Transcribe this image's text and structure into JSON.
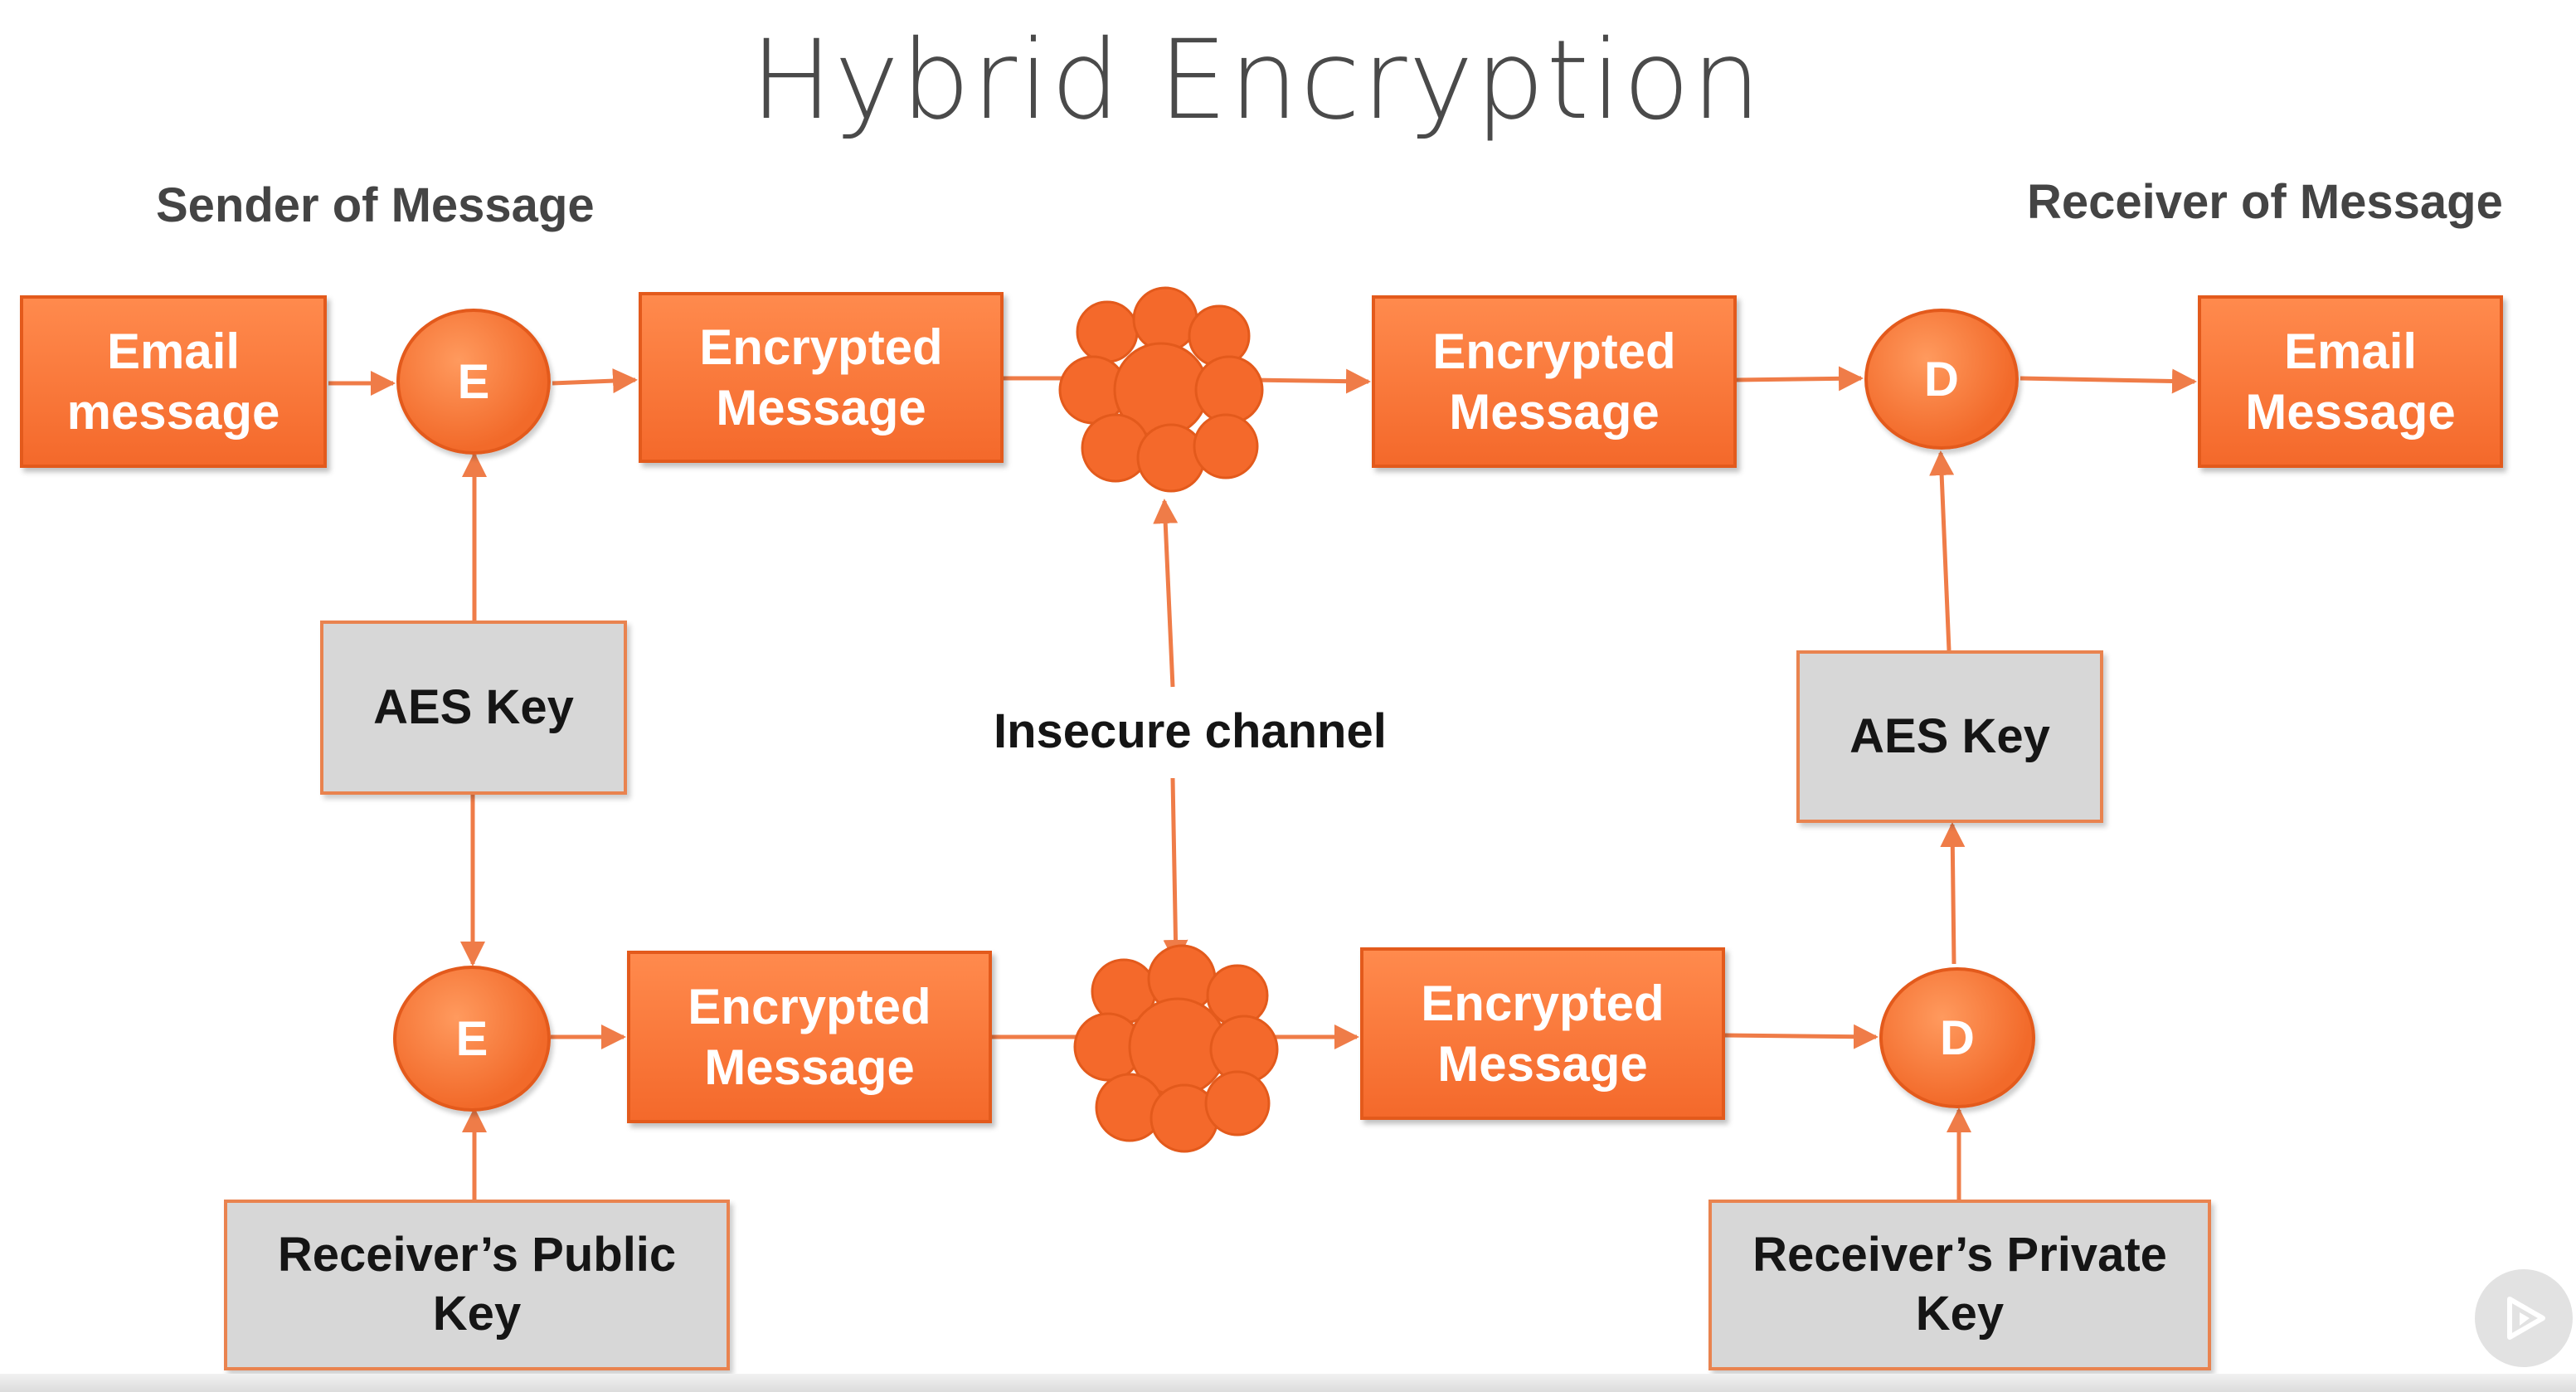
{
  "title": "Hybrid Encryption",
  "sender_heading": "Sender of Message",
  "receiver_heading": "Receiver of Message",
  "channel_label": "Insecure channel",
  "top_row": {
    "email_in": [
      "Email",
      "message"
    ],
    "encrypt_label": "E",
    "encrypted_left": [
      "Encrypted",
      "Message"
    ],
    "encrypted_right": [
      "Encrypted",
      "Message"
    ],
    "decrypt_label": "D",
    "email_out": [
      "Email",
      "Message"
    ]
  },
  "bottom_row": {
    "encrypt_label": "E",
    "encrypted_left": [
      "Encrypted",
      "Message"
    ],
    "encrypted_right": [
      "Encrypted",
      "Message"
    ],
    "decrypt_label": "D"
  },
  "keys": {
    "aes_sender": "AES Key",
    "aes_receiver": "AES Key",
    "public_key": [
      "Receiver’s Public",
      "Key"
    ],
    "private_key": [
      "Receiver’s Private",
      "Key"
    ]
  },
  "colors": {
    "accent": "#f4692b",
    "arrow": "#ef7c48",
    "key_box": "#d7d7d7"
  },
  "icons": {
    "channel_cloud": "cloud-icon",
    "player_button": "play-icon"
  }
}
